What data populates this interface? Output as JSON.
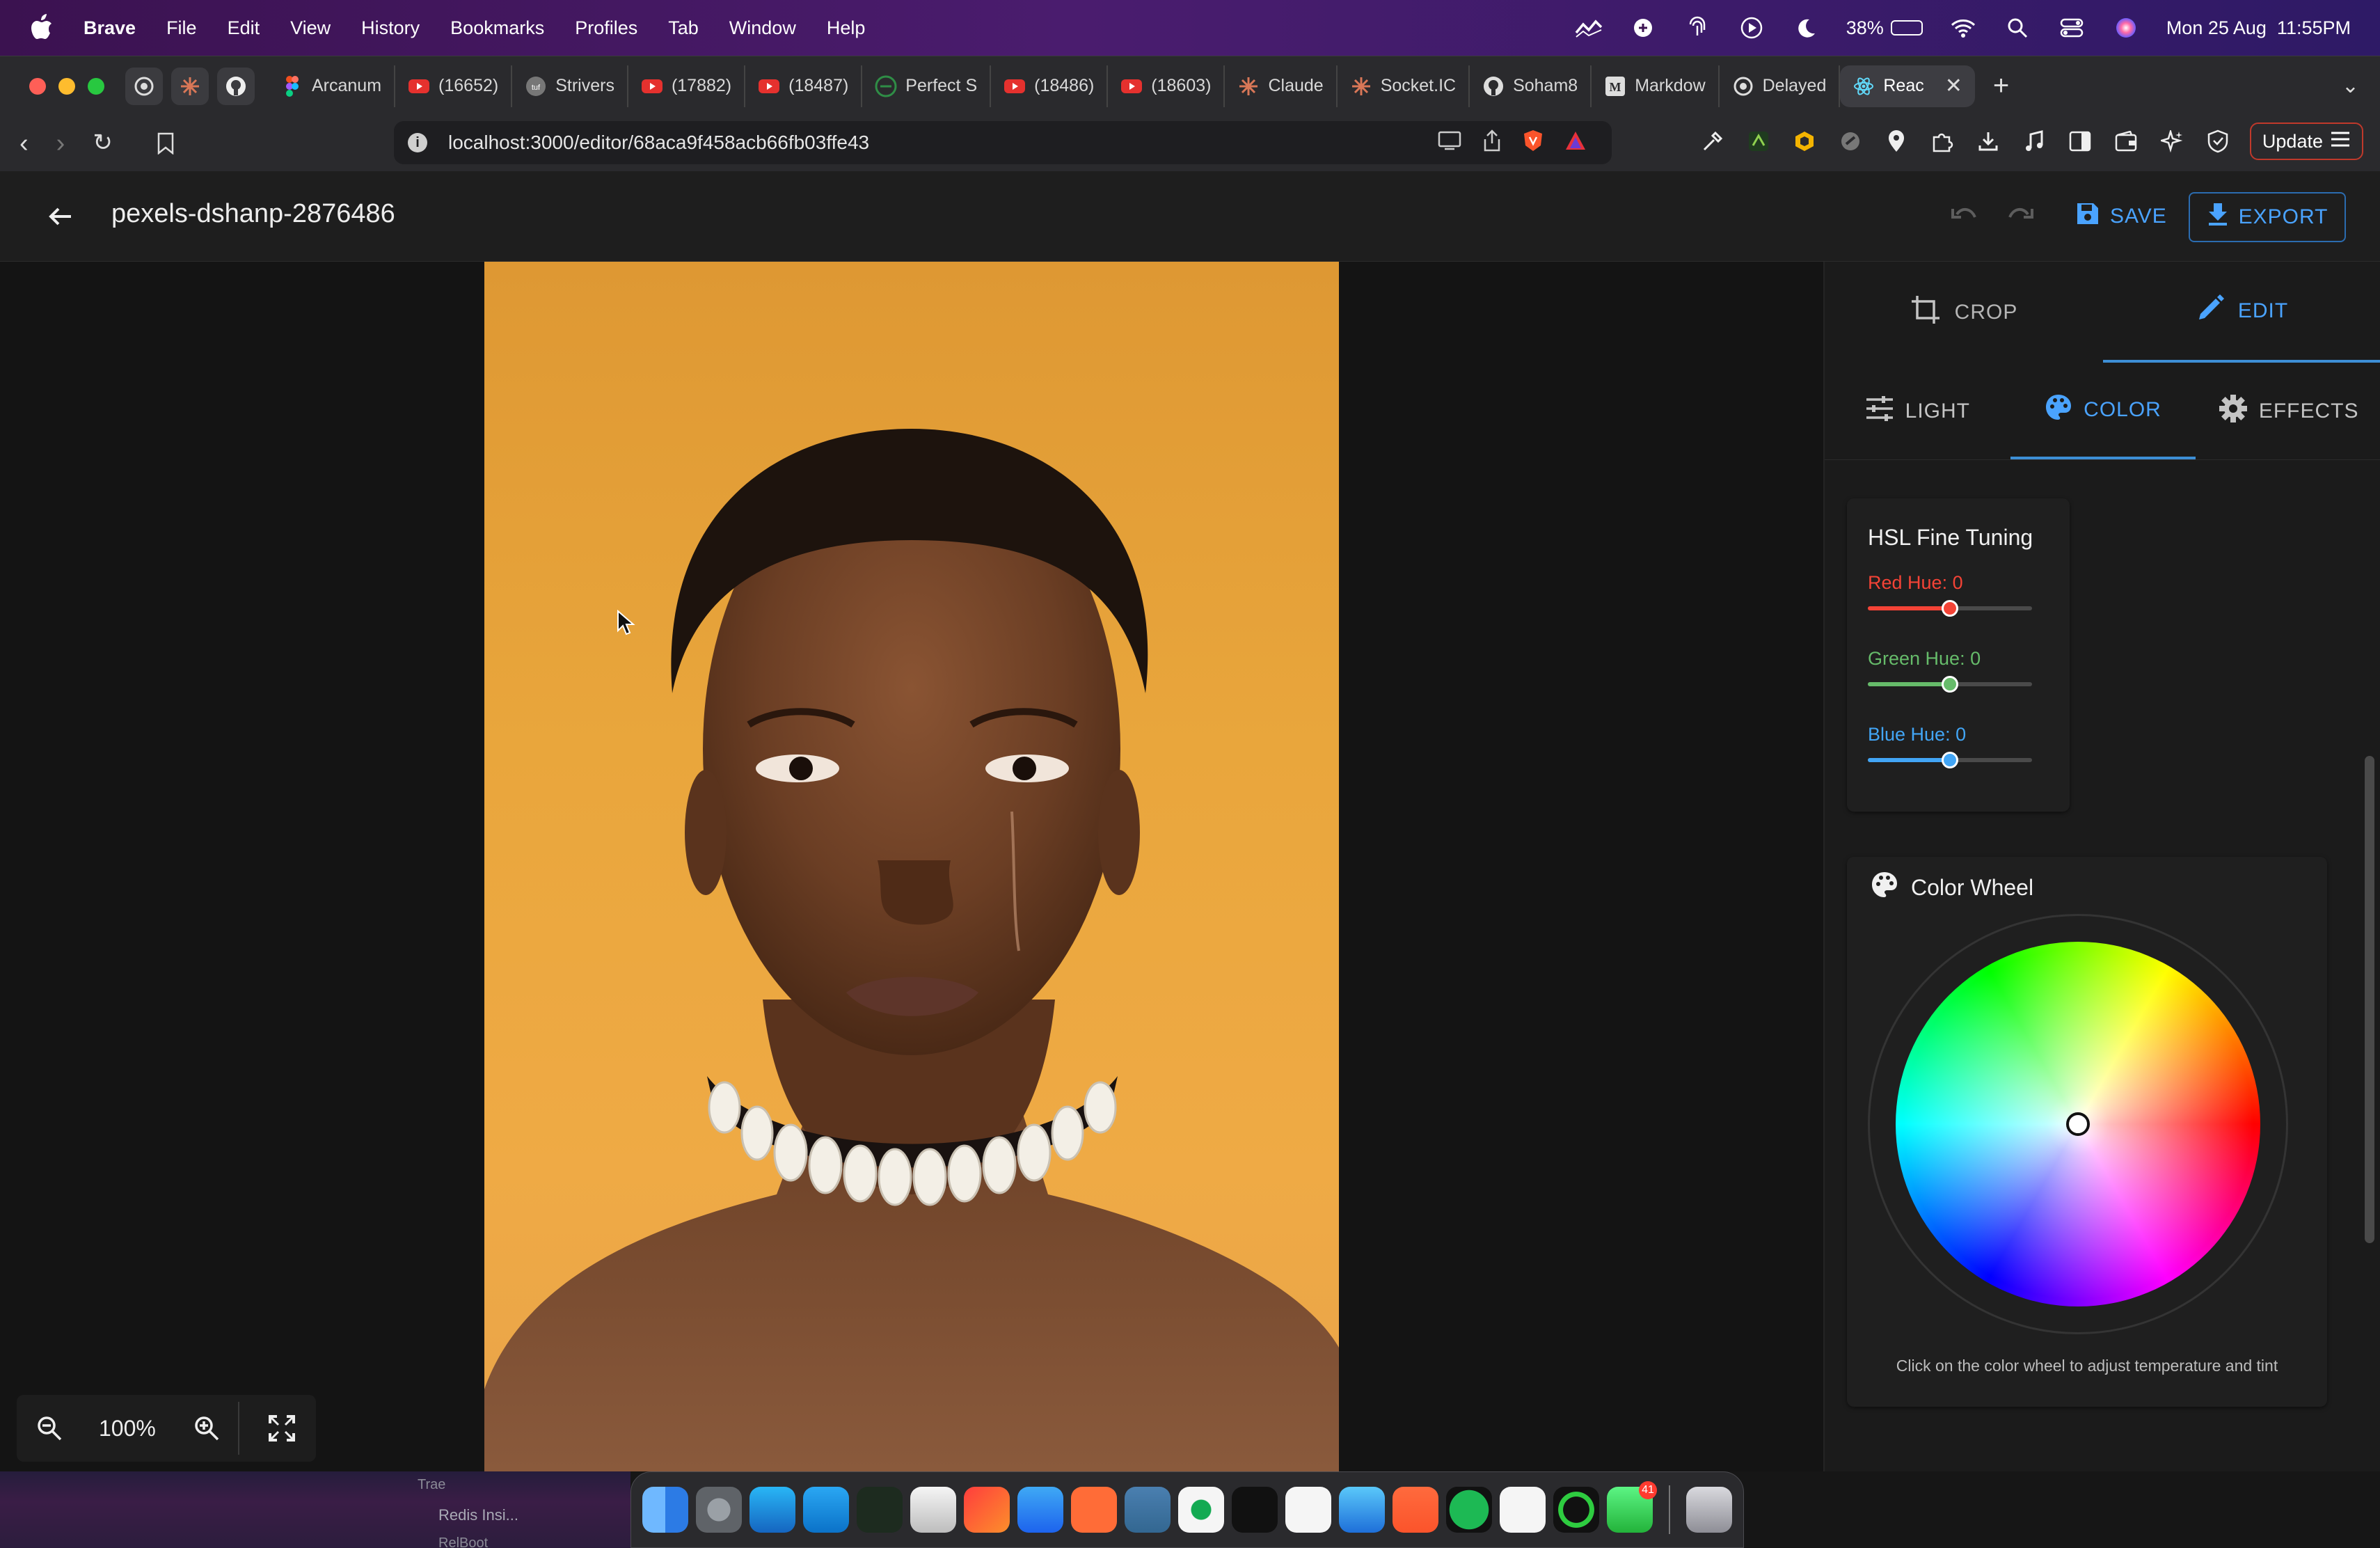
{
  "menubar": {
    "app_name": "Brave",
    "items": [
      "File",
      "Edit",
      "View",
      "History",
      "Bookmarks",
      "Profiles",
      "Tab",
      "Window",
      "Help"
    ],
    "battery_percent": "38%",
    "battery_level": 0.38,
    "datetime": "Mon 25 Aug  11:55PM"
  },
  "tabs": [
    {
      "label": "Arcanum",
      "icon": "figma-icon",
      "color": "#a259ff"
    },
    {
      "label": "(16652)",
      "icon": "youtube-icon",
      "color": "#e5312e"
    },
    {
      "label": "Strivers",
      "icon": "tuf-icon",
      "color": "#777777"
    },
    {
      "label": "(17882)",
      "icon": "youtube-icon",
      "color": "#e5312e"
    },
    {
      "label": "(18487)",
      "icon": "youtube-icon",
      "color": "#e5312e"
    },
    {
      "label": "Perfect S",
      "icon": "gfg-icon",
      "color": "#2f8d46"
    },
    {
      "label": "(18486)",
      "icon": "youtube-icon",
      "color": "#e5312e"
    },
    {
      "label": "(18603)",
      "icon": "youtube-icon",
      "color": "#e5312e"
    },
    {
      "label": "Claude",
      "icon": "claude-icon",
      "color": "#d97757"
    },
    {
      "label": "Socket.IC",
      "icon": "claude-icon",
      "color": "#d97757"
    },
    {
      "label": "Soham8",
      "icon": "github-icon",
      "color": "#dddddd"
    },
    {
      "label": "Markdow",
      "icon": "medium-icon",
      "color": "#dddddd"
    },
    {
      "label": "Delayed",
      "icon": "openai-icon",
      "color": "#dddddd"
    }
  ],
  "active_tab": {
    "label": "Reac",
    "icon": "react-icon"
  },
  "address": {
    "url": "localhost:3000/editor/68aca9f458acb66fb03ffe43"
  },
  "update_label": "Update",
  "editor": {
    "title": "pexels-dshanp-2876486",
    "save_label": "SAVE",
    "export_label": "EXPORT",
    "zoom": "100%"
  },
  "panel": {
    "mode_tabs": [
      {
        "label": "CROP",
        "icon": "crop-icon",
        "active": false
      },
      {
        "label": "EDIT",
        "icon": "pencil-icon",
        "active": true
      }
    ],
    "sub_tabs": [
      {
        "label": "LIGHT",
        "icon": "sliders-icon",
        "active": false
      },
      {
        "label": "COLOR",
        "icon": "palette-icon",
        "active": true
      },
      {
        "label": "EFFECTS",
        "icon": "gear-icon",
        "active": false
      }
    ],
    "hsl": {
      "title": "HSL Fine Tuning",
      "sliders": [
        {
          "label": "Red Hue: 0",
          "value": 0,
          "min": -180,
          "max": 180,
          "color": "#f44336"
        },
        {
          "label": "Green Hue: 0",
          "value": 0,
          "min": -180,
          "max": 180,
          "color": "#66bb6a"
        },
        {
          "label": "Blue Hue: 0",
          "value": 0,
          "min": -180,
          "max": 180,
          "color": "#42a5f5"
        }
      ]
    },
    "color_wheel": {
      "title": "Color Wheel",
      "hint": "Click on the color wheel to adjust temperature and tint"
    }
  },
  "dock": {
    "apps": [
      "finder-icon",
      "system-settings-icon",
      "app-store-icon",
      "vscode-icon",
      "terminal-green-icon",
      "keynote-icon",
      "pycharm-icon",
      "docker-icon",
      "postman-icon",
      "postgres-icon",
      "mongodb-icon",
      "terminal-icon",
      "notion-icon",
      "xcode-icon",
      "brave-icon",
      "spotify-icon",
      "ollama-icon",
      "activity-icon",
      "whatsapp-icon",
      "trash-icon"
    ],
    "whatsapp_badge": "41"
  },
  "background_ghost": [
    "Trae",
    "Redis Insi...",
    "RelBoot"
  ]
}
